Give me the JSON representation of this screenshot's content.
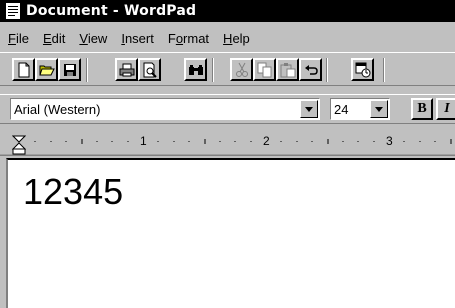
{
  "window": {
    "title": "Document - WordPad"
  },
  "menu": [
    {
      "label": "File",
      "mnemonic_index": 0
    },
    {
      "label": "Edit",
      "mnemonic_index": 0
    },
    {
      "label": "View",
      "mnemonic_index": 0
    },
    {
      "label": "Insert",
      "mnemonic_index": 0
    },
    {
      "label": "Format",
      "mnemonic_index": 1
    },
    {
      "label": "Help",
      "mnemonic_index": 0
    }
  ],
  "toolbar": {
    "buttons": [
      {
        "name": "new-icon",
        "enabled": true
      },
      {
        "name": "open-icon",
        "enabled": true
      },
      {
        "name": "save-icon",
        "enabled": true
      },
      {
        "name": "print-icon",
        "enabled": true
      },
      {
        "name": "print-preview-icon",
        "enabled": true
      },
      {
        "name": "find-icon",
        "enabled": true
      },
      {
        "name": "cut-icon",
        "enabled": false
      },
      {
        "name": "copy-icon",
        "enabled": false
      },
      {
        "name": "paste-icon",
        "enabled": false
      },
      {
        "name": "undo-icon",
        "enabled": true
      },
      {
        "name": "date-time-icon",
        "enabled": true
      }
    ]
  },
  "format_bar": {
    "font": "Arial (Western)",
    "size": "24",
    "bold_label": "B",
    "italic_label": "I"
  },
  "ruler": {
    "numbers": [
      "1",
      "2",
      "3"
    ]
  },
  "document": {
    "text": "12345"
  }
}
